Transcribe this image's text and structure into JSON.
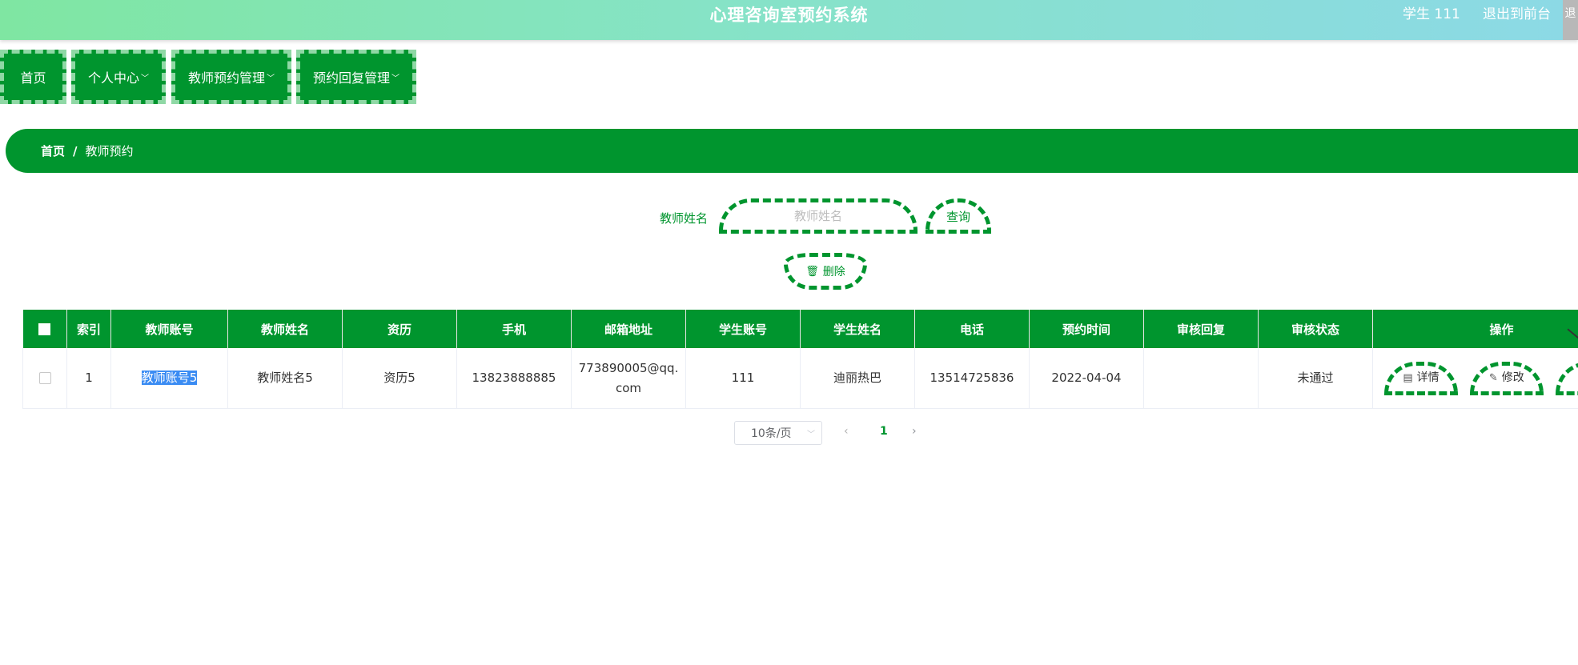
{
  "app": {
    "title": "心理咨询室预约系统"
  },
  "header": {
    "user": "学生 111",
    "exit": "退出到前台",
    "edge": "退"
  },
  "nav": {
    "items": [
      {
        "label": "首页",
        "has_dropdown": false
      },
      {
        "label": "个人中心",
        "has_dropdown": true
      },
      {
        "label": "教师预约管理",
        "has_dropdown": true
      },
      {
        "label": "预约回复管理",
        "has_dropdown": true
      }
    ],
    "chevron": "﹀"
  },
  "breadcrumb": {
    "home": "首页",
    "separator": "/",
    "current": "教师预约"
  },
  "search": {
    "label": "教师姓名",
    "placeholder": "教师姓名",
    "value": "",
    "button": "查询"
  },
  "actions": {
    "delete": "删除",
    "delete_icon": "trash-icon"
  },
  "table": {
    "columns": [
      "",
      "索引",
      "教师账号",
      "教师姓名",
      "资历",
      "手机",
      "邮箱地址",
      "学生账号",
      "学生姓名",
      "电话",
      "预约时间",
      "审核回复",
      "审核状态",
      "操作"
    ],
    "rows": [
      {
        "index": "1",
        "teacher_account": "教师账号5",
        "teacher_name": "教师姓名5",
        "qualification": "资历5",
        "mobile": "13823888885",
        "email": "773890005@qq.com",
        "student_account": "111",
        "student_name": "迪丽热巴",
        "phone": "13514725836",
        "appointment_time": "2022-04-04",
        "review_reply": "",
        "review_status": "未通过",
        "ops": {
          "detail": "详情",
          "edit": "修改"
        }
      }
    ]
  },
  "pagination": {
    "page_size": "10条/页",
    "current_page": "1",
    "prev": "‹",
    "next": "›"
  },
  "colors": {
    "primary": "#00952e",
    "dash_light": "#8fd8a5",
    "selection": "#3b8cf3"
  }
}
